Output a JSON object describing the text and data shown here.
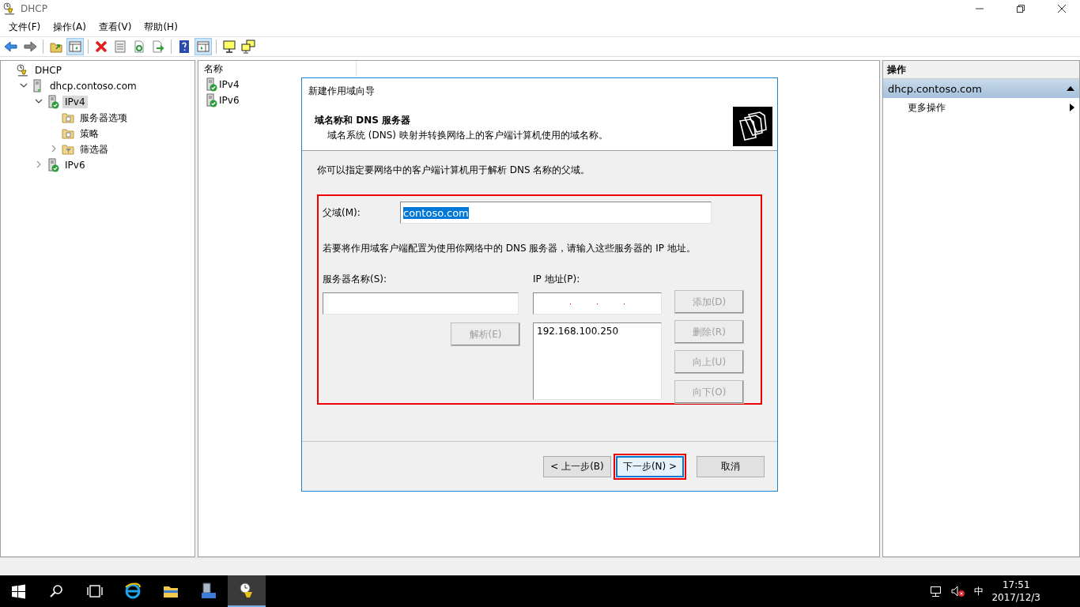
{
  "window": {
    "title": "DHCP"
  },
  "menu": [
    "文件(F)",
    "操作(A)",
    "查看(V)",
    "帮助(H)"
  ],
  "toolbar": [
    {
      "kind": "back",
      "pressed": false
    },
    {
      "kind": "forward",
      "pressed": false
    },
    {
      "kind": "sep"
    },
    {
      "kind": "up",
      "pressed": false
    },
    {
      "kind": "tree",
      "pressed": true
    },
    {
      "kind": "sep"
    },
    {
      "kind": "delete",
      "pressed": false
    },
    {
      "kind": "properties",
      "pressed": false
    },
    {
      "kind": "refresh",
      "pressed": false
    },
    {
      "kind": "export",
      "pressed": false
    },
    {
      "kind": "sep"
    },
    {
      "kind": "help",
      "pressed": false
    },
    {
      "kind": "pane",
      "pressed": true
    },
    {
      "kind": "sep"
    },
    {
      "kind": "monitor",
      "pressed": false
    },
    {
      "kind": "monitors",
      "pressed": false
    }
  ],
  "tree": [
    {
      "label": "DHCP",
      "kind": "root",
      "children": [
        {
          "label": "dhcp.contoso.com",
          "kind": "server",
          "expanded": true,
          "selected": false,
          "children": [
            {
              "label": "IPv4",
              "kind": "scope",
              "expanded": true,
              "selected": true,
              "children": [
                {
                  "label": "服务器选项",
                  "kind": "folder",
                  "selected": false
                },
                {
                  "label": "策略",
                  "kind": "folder",
                  "selected": false
                },
                {
                  "label": "筛选器",
                  "kind": "filter",
                  "expanded": false,
                  "selected": false
                }
              ]
            },
            {
              "label": "IPv6",
              "kind": "scope",
              "expanded": false,
              "selected": false
            }
          ]
        }
      ]
    }
  ],
  "list": {
    "column": "名称",
    "items": [
      "IPv4",
      "IPv6"
    ]
  },
  "actions": {
    "header": "操作",
    "section": "dhcp.contoso.com",
    "items": [
      "更多操作"
    ]
  },
  "dialog": {
    "title": "新建作用域向导",
    "heading": "域名称和 DNS 服务器",
    "subheading": "域名系统 (DNS) 映射并转换网络上的客户端计算机使用的域名称。",
    "intro": "你可以指定要网络中的客户端计算机用于解析 DNS 名称的父域。",
    "highlighted": true,
    "parent_domain": {
      "label": "父域(M):",
      "value": "contoso.com",
      "selected": true
    },
    "note": "若要将作用域客户端配置为使用你网络中的 DNS 服务器，请输入这些服务器的 IP 地址。",
    "server_name": {
      "label": "服务器名称(S):"
    },
    "resolve_button": {
      "label": "解析(E)",
      "disabled": true
    },
    "ip": {
      "label": "IP 地址(P):"
    },
    "ip_list": [
      "192.168.100.250"
    ],
    "side_buttons": [
      {
        "label": "添加(D)",
        "disabled": true
      },
      {
        "label": "删除(R)",
        "disabled": true
      },
      {
        "label": "向上(U)",
        "disabled": true
      },
      {
        "label": "向下(O)",
        "disabled": true
      }
    ],
    "nav_buttons": [
      {
        "label": "< 上一步(B)",
        "focused": false,
        "highlighted": false
      },
      {
        "label": "下一步(N) >",
        "focused": true,
        "highlighted": true
      },
      {
        "label": "取消",
        "focused": false,
        "highlighted": false
      }
    ]
  },
  "taskbar": [
    {
      "kind": "start",
      "active": false
    },
    {
      "kind": "search",
      "active": false
    },
    {
      "kind": "taskview",
      "active": false
    },
    {
      "kind": "browser",
      "active": false
    },
    {
      "kind": "explorer",
      "active": false
    },
    {
      "kind": "servermanager",
      "active": false
    },
    {
      "kind": "dhcp",
      "active": true
    }
  ],
  "tray": {
    "ime": "中",
    "time": "17:51",
    "date": "2017/12/3"
  }
}
